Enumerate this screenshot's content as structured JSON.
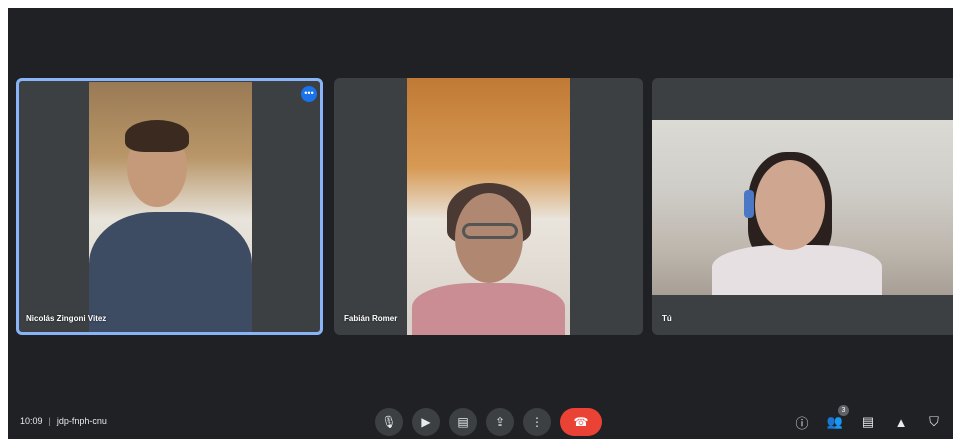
{
  "participants": [
    {
      "name": "Nicolás Zingoni Vitez"
    },
    {
      "name": "Fabián Romer"
    },
    {
      "name": "Tú"
    }
  ],
  "tile_menu_icon": "more-dots-icon",
  "meeting": {
    "time": "10:09",
    "separator": "|",
    "code": "jdp-fnph-cnu"
  },
  "controls": [
    {
      "name": "mic-icon",
      "glyph": "🎙"
    },
    {
      "name": "camera-icon",
      "glyph": "▶"
    },
    {
      "name": "captions-icon",
      "glyph": "▤"
    },
    {
      "name": "present-icon",
      "glyph": "⇪"
    },
    {
      "name": "more-options-icon",
      "glyph": "⋮"
    },
    {
      "name": "end-call-icon",
      "glyph": "☎"
    }
  ],
  "right_tools": {
    "info_glyph": "ⓘ",
    "people_glyph": "👥",
    "people_count": "3",
    "chat_glyph": "▤",
    "activities_glyph": "▲",
    "host_glyph": "⛉"
  },
  "colors": {
    "background": "#202124",
    "tile": "#3c4043",
    "active_border": "#8ab4f8",
    "end_call": "#ea4335"
  }
}
